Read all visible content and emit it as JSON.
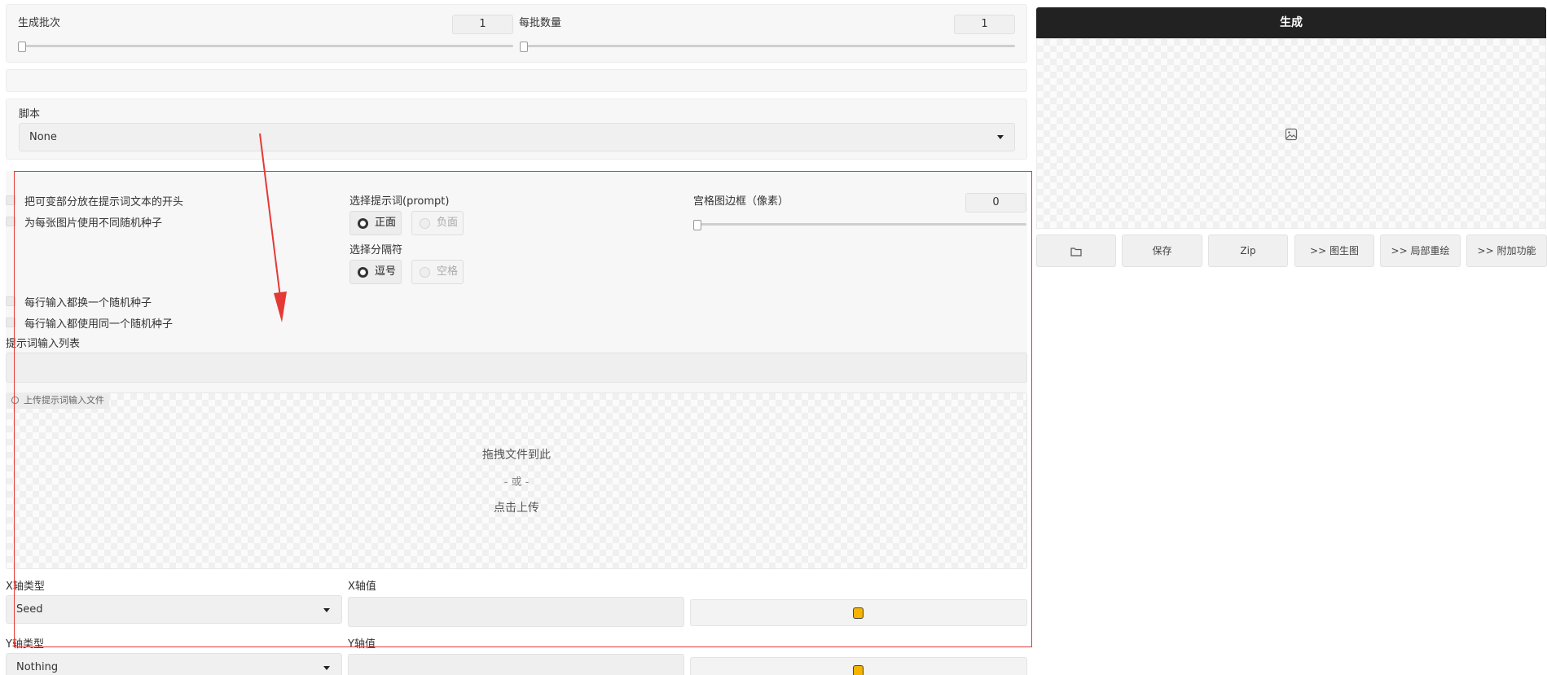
{
  "batch": {
    "count_label": "生成批次",
    "count_value": "1",
    "size_label": "每批数量",
    "size_value": "1"
  },
  "script": {
    "label": "脚本",
    "selected": "None"
  },
  "options": {
    "checkbox_put_variable_start": "把可变部分放在提示词文本的开头",
    "checkbox_different_seeds": "为每张图片使用不同随机种子",
    "select_prompt_label": "选择提示词(prompt)",
    "prompt_positive": "正面",
    "prompt_negative": "负面",
    "select_separator_label": "选择分隔符",
    "sep_comma": "逗号",
    "sep_space": "空格",
    "grid_margin_label": "宫格图边框（像素）",
    "grid_margin_value": "0",
    "checkbox_iterate_seed": "每行输入都换一个随机种子",
    "checkbox_same_seed": "每行输入都使用同一个随机种子",
    "prompt_list_label": "提示词输入列表",
    "upload_tab_label": "上传提示词输入文件",
    "drop_text": "拖拽文件到此",
    "or_text": "- 或 -",
    "click_upload": "点击上传"
  },
  "xy": {
    "x_type_label": "X轴类型",
    "x_type_value": "Seed",
    "x_values_label": "X轴值",
    "y_type_label": "Y轴类型",
    "y_type_value": "Nothing",
    "y_values_label": "Y轴值"
  },
  "right": {
    "generate_label": "生成",
    "buttons": {
      "save": "保存",
      "zip": "Zip",
      "img2img": ">> 图生图",
      "inpaint": ">> 局部重绘",
      "extras": ">> 附加功能"
    }
  },
  "colors": {
    "annotation_red": "#e53935",
    "generate_bg": "#222222",
    "dice": "#f5b400"
  }
}
